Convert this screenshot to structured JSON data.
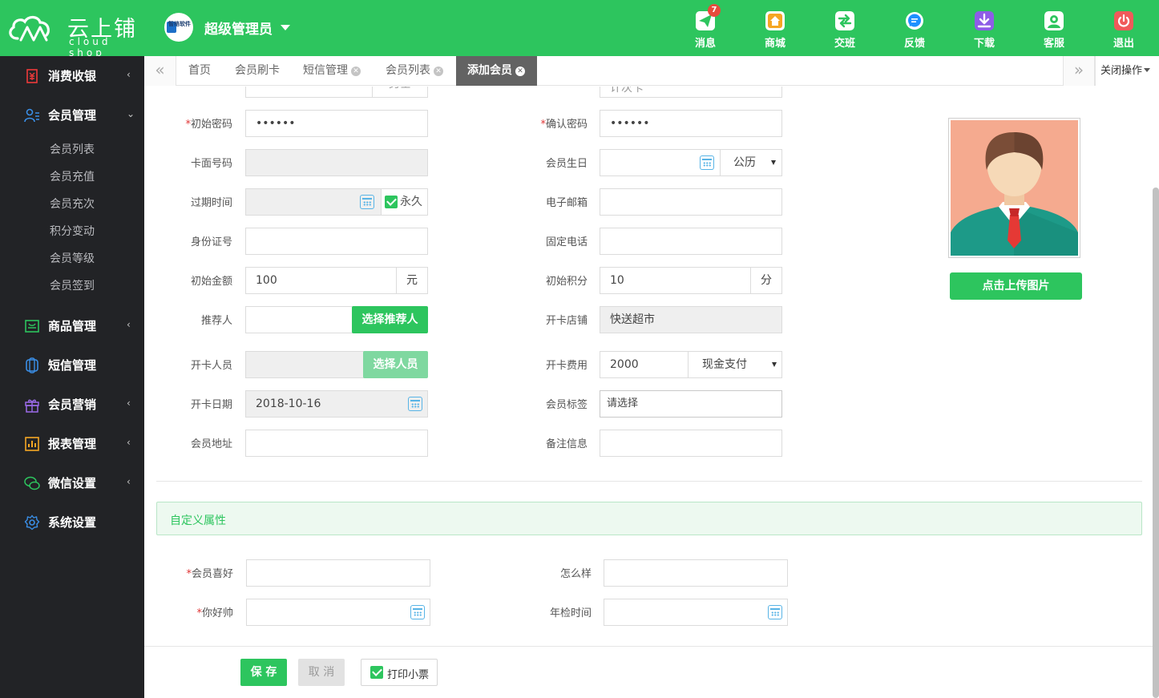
{
  "app": {
    "logo_title": "云上铺",
    "logo_sub": "cloud shop",
    "admin_name": "超级管理员",
    "admin_avatar_text": "智络软件"
  },
  "top_actions": [
    {
      "label": "消息",
      "icon": "send-icon",
      "badge": "7",
      "color": "#2dc55e"
    },
    {
      "label": "商城",
      "icon": "store-icon",
      "color": "#f5a623"
    },
    {
      "label": "交班",
      "icon": "swap-icon",
      "color": "#2dc55e"
    },
    {
      "label": "反馈",
      "icon": "chat-icon",
      "color": "#1e90ff"
    },
    {
      "label": "下载",
      "icon": "download-icon",
      "color": "#8e5ce6"
    },
    {
      "label": "客服",
      "icon": "support-icon",
      "color": "#2dc55e"
    },
    {
      "label": "退出",
      "icon": "power-icon",
      "color": "#f05a5a"
    }
  ],
  "sidebar": {
    "items": [
      {
        "label": "消费收银",
        "icon": "cashier-icon",
        "color": "#ee3a3a"
      },
      {
        "label": "会员管理",
        "icon": "members-icon",
        "color": "#3a8ee6"
      },
      {
        "label": "商品管理",
        "icon": "goods-icon",
        "color": "#2dc55e"
      },
      {
        "label": "短信管理",
        "icon": "sms-icon",
        "color": "#3a8ee6"
      },
      {
        "label": "会员营销",
        "icon": "gift-icon",
        "color": "#9b6be8"
      },
      {
        "label": "报表管理",
        "icon": "report-icon",
        "color": "#f5a623"
      },
      {
        "label": "微信设置",
        "icon": "wechat-icon",
        "color": "#2dc55e"
      },
      {
        "label": "系统设置",
        "icon": "settings-icon",
        "color": "#3a8ee6"
      }
    ],
    "subitems": [
      "会员列表",
      "会员充值",
      "会员充次",
      "积分变动",
      "会员等级",
      "会员签到"
    ]
  },
  "tabs": {
    "items": [
      {
        "label": "首页",
        "closable": false
      },
      {
        "label": "会员刷卡",
        "closable": false
      },
      {
        "label": "短信管理",
        "closable": true
      },
      {
        "label": "会员列表",
        "closable": true
      },
      {
        "label": "添加会员",
        "closable": true,
        "active": true
      }
    ],
    "close_ops": "关闭操作"
  },
  "form": {
    "partial_top": {
      "left_value": "男士",
      "right_value": "计次卡"
    },
    "init_password": {
      "label": "初始密码",
      "value": "••••••",
      "required": true
    },
    "confirm_password": {
      "label": "确认密码",
      "value": "••••••",
      "required": true
    },
    "card_number": {
      "label": "卡面号码",
      "value": ""
    },
    "birthday": {
      "label": "会员生日",
      "calendar": "公历"
    },
    "expire": {
      "label": "过期时间",
      "permanent_label": "永久",
      "permanent_checked": true
    },
    "email": {
      "label": "电子邮箱",
      "value": ""
    },
    "id_number": {
      "label": "身份证号",
      "value": ""
    },
    "phone": {
      "label": "固定电话",
      "value": ""
    },
    "init_amount": {
      "label": "初始金额",
      "value": "100",
      "unit": "元"
    },
    "init_points": {
      "label": "初始积分",
      "value": "10",
      "unit": "分"
    },
    "referrer": {
      "label": "推荐人",
      "button": "选择推荐人"
    },
    "open_store": {
      "label": "开卡店铺",
      "value": "快送超市"
    },
    "open_staff": {
      "label": "开卡人员",
      "button": "选择人员"
    },
    "open_fee": {
      "label": "开卡费用",
      "value": "2000",
      "payment": "现金支付"
    },
    "open_date": {
      "label": "开卡日期",
      "value": "2018-10-16"
    },
    "tags": {
      "label": "会员标签",
      "placeholder": "请选择"
    },
    "address": {
      "label": "会员地址",
      "value": ""
    },
    "remark": {
      "label": "备注信息",
      "value": ""
    },
    "upload_button": "点击上传图片"
  },
  "custom": {
    "title": "自定义属性",
    "hobby": {
      "label": "会员喜好",
      "required": true
    },
    "how": {
      "label": "怎么样"
    },
    "handsome": {
      "label": "你好帅",
      "required": true
    },
    "inspection": {
      "label": "年检时间"
    }
  },
  "actions": {
    "save": "保 存",
    "cancel": "取 消",
    "print_receipt": "打印小票",
    "print_checked": true
  }
}
